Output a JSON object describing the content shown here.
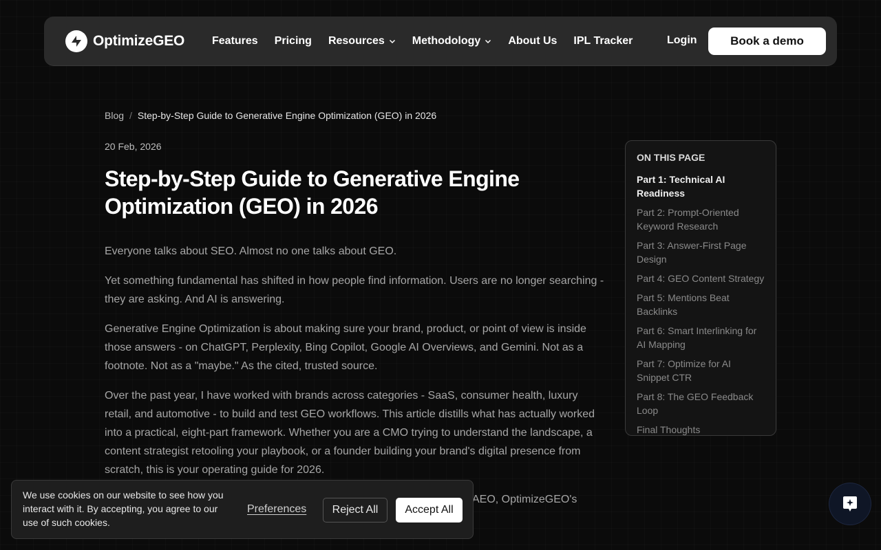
{
  "brand": {
    "name": "OptimizeGEO"
  },
  "nav": {
    "items": [
      {
        "label": "Features",
        "dropdown": false
      },
      {
        "label": "Pricing",
        "dropdown": false
      },
      {
        "label": "Resources",
        "dropdown": true
      },
      {
        "label": "Methodology",
        "dropdown": true
      },
      {
        "label": "About Us",
        "dropdown": false
      },
      {
        "label": "IPL Tracker",
        "dropdown": false
      }
    ],
    "login": "Login",
    "demo": "Book a demo"
  },
  "breadcrumb": {
    "root": "Blog",
    "separator": "/",
    "current": "Step-by-Step Guide to Generative Engine Optimization (GEO) in 2026"
  },
  "article": {
    "date": "20 Feb, 2026",
    "title": "Step-by-Step Guide to Generative Engine Optimization (GEO) in 2026",
    "paragraphs": [
      "Everyone talks about SEO. Almost no one talks about GEO.",
      "Yet something fundamental has shifted in how people find information. Users are no longer searching - they are asking. And AI is answering.",
      "Generative Engine Optimization is about making sure your brand, product, or point of view is inside those answers - on ChatGPT, Perplexity, Bing Copilot, Google AI Overviews, and Gemini. Not as a footnote. Not as a \"maybe.\" As the cited, trusted source.",
      "Over the past year, I have worked with brands across categories - SaaS, consumer health, luxury retail, and automotive - to build and test GEO workflows. This article distills what has actually worked into a practical, eight-part framework. Whether you are a CMO trying to understand the landscape, a content strategist retooling your playbook, or a founder building your brand's digital presence from scratch, this is your operating guide for 2026."
    ],
    "partial_line": "AEO, OptimizeGEO's"
  },
  "toc": {
    "heading": "ON THIS PAGE",
    "items": [
      {
        "label": "Part 1: Technical AI Readiness",
        "active": true
      },
      {
        "label": "Part 2: Prompt-Oriented Keyword Research",
        "active": false
      },
      {
        "label": "Part 3: Answer-First Page Design",
        "active": false
      },
      {
        "label": "Part 4: GEO Content Strategy",
        "active": false
      },
      {
        "label": "Part 5: Mentions Beat Backlinks",
        "active": false
      },
      {
        "label": "Part 6: Smart Interlinking for AI Mapping",
        "active": false
      },
      {
        "label": "Part 7: Optimize for AI Snippet CTR",
        "active": false
      },
      {
        "label": "Part 8: The GEO Feedback Loop",
        "active": false
      },
      {
        "label": "Final Thoughts",
        "active": false
      }
    ]
  },
  "cookie": {
    "text": "We use cookies on our website to see how you interact with it. By accepting, you agree to our use of such cookies.",
    "preferences": "Preferences",
    "reject": "Reject All",
    "accept": "Accept All"
  },
  "icons": {
    "logo": "optimizegeo-logo-icon",
    "chevron": "chevron-down-icon",
    "chat": "chat-sparkle-icon"
  },
  "colors": {
    "background": "#0b0b0b",
    "nav_bg": "#2a2a2a",
    "text_muted": "#a6a6a6",
    "button_light": "#ffffff",
    "chat_bg": "#0f1626"
  }
}
